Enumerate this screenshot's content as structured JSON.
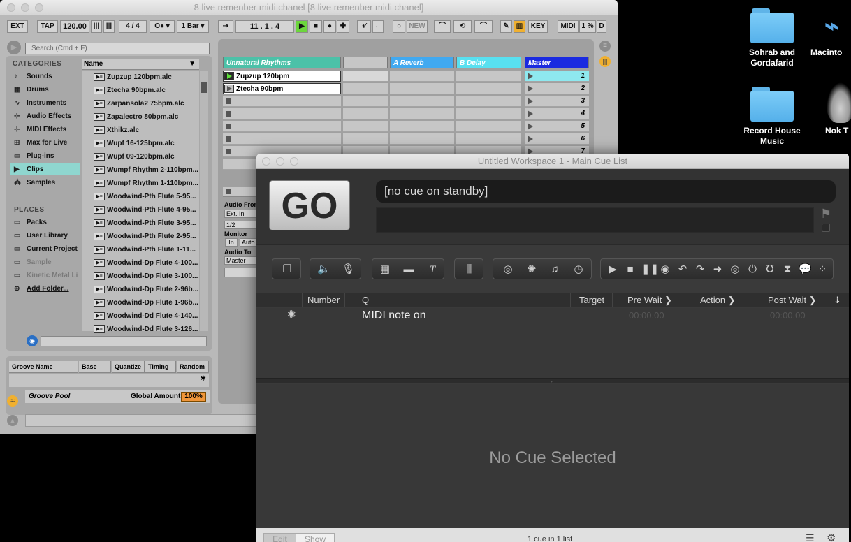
{
  "desktop": {
    "icons": [
      {
        "label": "Sohrab and Gordafarid",
        "type": "folder"
      },
      {
        "label": "Macinto",
        "type": "drive"
      },
      {
        "label": "Record House Music",
        "type": "folder"
      },
      {
        "label": "Nok T",
        "type": "image"
      }
    ]
  },
  "live": {
    "title": "8 live remenber midi chanel  [8 live remenber midi chanel]",
    "toolbar": {
      "ext": "EXT",
      "tap": "TAP",
      "tempo": "120.00",
      "sig": "4 / 4",
      "quant": "1 Bar",
      "position": "11 .   1 .   4",
      "new": "NEW",
      "key": "KEY",
      "midi": "MIDI",
      "cpu": "1 %",
      "d": "D"
    },
    "search_placeholder": "Search (Cmd + F)",
    "categories_header": "CATEGORIES",
    "categories": [
      {
        "label": "Sounds",
        "icon": "♪"
      },
      {
        "label": "Drums",
        "icon": "▦"
      },
      {
        "label": "Instruments",
        "icon": "∿"
      },
      {
        "label": "Audio Effects",
        "icon": "⊹"
      },
      {
        "label": "MIDI Effects",
        "icon": "⊹"
      },
      {
        "label": "Max for Live",
        "icon": "⊞"
      },
      {
        "label": "Plug-ins",
        "icon": "▭"
      },
      {
        "label": "Clips",
        "icon": "▶"
      },
      {
        "label": "Samples",
        "icon": "⁂"
      }
    ],
    "places_header": "PLACES",
    "places": [
      "Packs",
      "User Library",
      "Current Project",
      "Sample",
      "Kinetic Metal Li",
      "Add Folder..."
    ],
    "name_header": "Name",
    "files": [
      "Zupzup 120bpm.alc",
      "Ztecha 90bpm.alc",
      "Zarpansola2 75bpm.alc",
      "Zapalectro 80bpm.alc",
      "Xthikz.alc",
      "Wupf 16-125bpm.alc",
      "Wupf 09-120bpm.alc",
      "Wumpf Rhythm 2-110bpm...",
      "Wumpf Rhythm 1-110bpm...",
      "Woodwind-Pth Flute 5-95...",
      "Woodwind-Pth Flute 4-95...",
      "Woodwind-Pth Flute 3-95...",
      "Woodwind-Pth Flute 2-95...",
      "Woodwind-Pth Flute 1-11...",
      "Woodwind-Dp Flute 4-100...",
      "Woodwind-Dp Flute 3-100...",
      "Woodwind-Dp Flute 2-96b...",
      "Woodwind-Dp Flute 1-96b...",
      "Woodwind-Dd Flute 4-140...",
      "Woodwind-Dd Flute 3-126..."
    ],
    "groove": {
      "cols": [
        "Groove Name",
        "Base",
        "Quantize",
        "Timing",
        "Random"
      ],
      "pool": "Groove Pool",
      "amount_label": "Global Amount",
      "amount": "100%"
    },
    "tracks": {
      "t1": "Unnatural Rhythms",
      "reverb": "A Reverb",
      "delay": "B Delay",
      "master": "Master",
      "clips": [
        "Zupzup 120bpm",
        "Ztecha 90bpm"
      ],
      "scenes": [
        "1",
        "2",
        "3",
        "4",
        "5",
        "6",
        "7"
      ]
    },
    "io": {
      "audio_from": "Audio From",
      "ext_in": "Ext. In",
      "ch": "1/2",
      "monitor": "Monitor",
      "in": "In",
      "auto": "Auto",
      "audio_to": "Audio To",
      "master": "Master"
    }
  },
  "qlab": {
    "title": "Untitled Workspace 1 - Main Cue List",
    "go": "GO",
    "standby": "[no cue on standby]",
    "columns": {
      "number": "Number",
      "q": "Q",
      "target": "Target",
      "prewait": "Pre Wait",
      "action": "Action",
      "postwait": "Post Wait"
    },
    "cue": {
      "name": "MIDI note on",
      "prewait": "00:00.00",
      "postwait": "00:00.00"
    },
    "no_selection": "No Cue Selected",
    "footer": {
      "edit": "Edit",
      "show": "Show",
      "status": "1 cue in 1 list"
    }
  }
}
